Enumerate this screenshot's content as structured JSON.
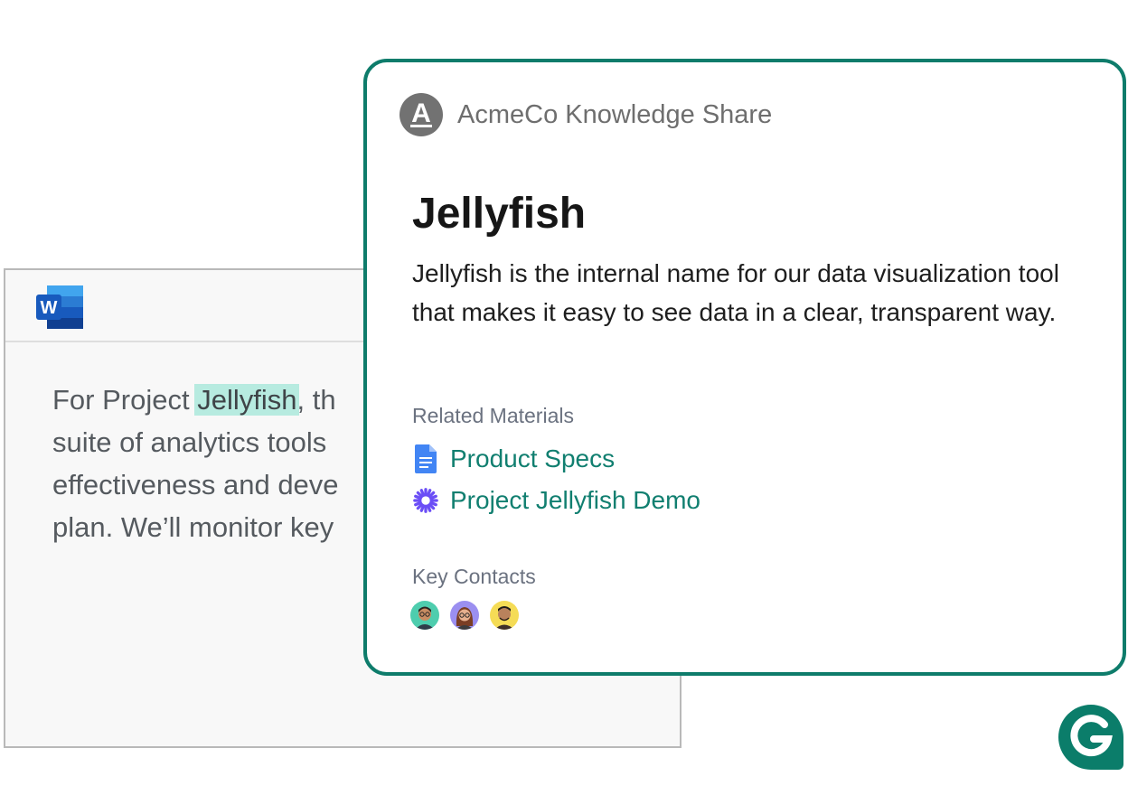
{
  "document": {
    "app_icon": "word-icon",
    "app_letter": "W",
    "lines": [
      {
        "before": "For Project ",
        "highlight": "Jellyfish",
        "after": ", th"
      },
      {
        "text": "suite of analytics tools "
      },
      {
        "text": "effectiveness and deve"
      },
      {
        "text": "plan. We’ll monitor key"
      }
    ]
  },
  "card": {
    "brand_icon": "acmeco-logo-icon",
    "brand_letter": "A",
    "brand_name": "AcmeCo Knowledge Share",
    "title": "Jellyfish",
    "description": "Jellyfish is the internal name for our data visualization tool that makes it easy to see data in a clear, transparent way.",
    "related_label": "Related Materials",
    "related": [
      {
        "icon": "google-doc-icon",
        "label": "Product Specs"
      },
      {
        "icon": "asterisk-icon",
        "label": "Project Jellyfish Demo"
      }
    ],
    "contacts_label": "Key Contacts",
    "contacts": [
      {
        "icon": "avatar-man-glasses"
      },
      {
        "icon": "avatar-woman-glasses"
      },
      {
        "icon": "avatar-man-yellow"
      }
    ]
  },
  "colors": {
    "card_border": "#0e7c6b",
    "link": "#117f70",
    "highlight": "#b7ebe0",
    "grammarly": "#0b7d6a"
  },
  "badge": {
    "icon": "grammarly-g-icon"
  }
}
